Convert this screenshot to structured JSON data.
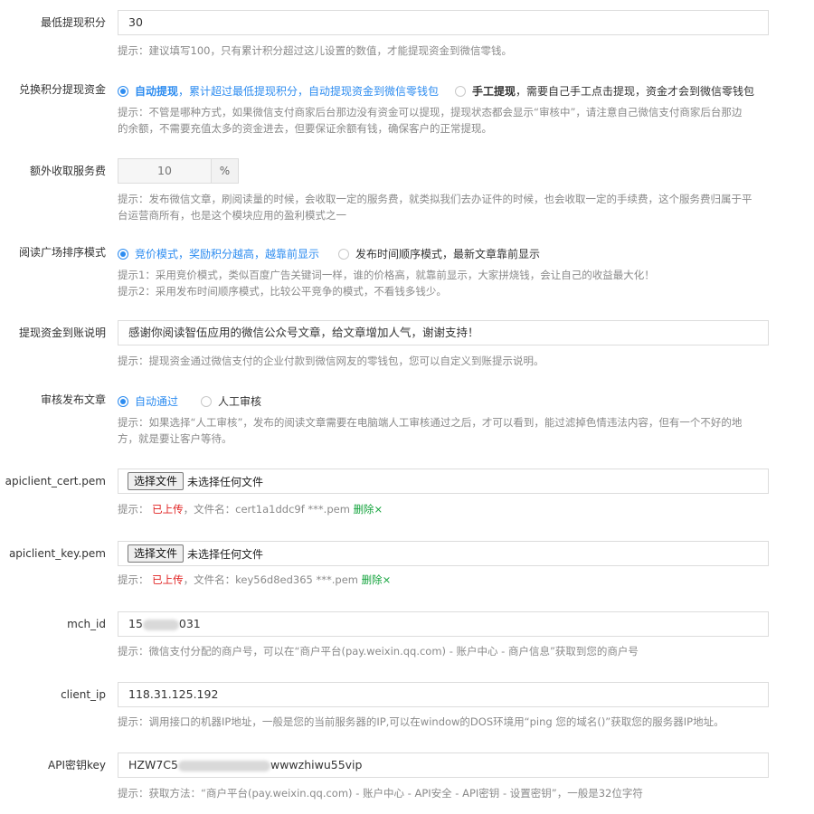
{
  "fields": {
    "min_points": {
      "label": "最低提现积分",
      "value": "30",
      "hint": "提示：建议填写100，只有累计积分超过这儿设置的数值，才能提现资金到微信零钱。"
    },
    "exchange_mode": {
      "label": "兑换积分提现资金",
      "option_auto_title": "自动提现",
      "option_auto_desc": "，累计超过最低提现积分，自动提现资金到微信零钱包",
      "option_manual_title": "手工提现",
      "option_manual_desc": "，需要自己手工点击提现，资金才会到微信零钱包",
      "selected": "auto",
      "hint_line1": "提示：不管是哪种方式，如果微信支付商家后台那边没有资金可以提现，提现状态都会显示“审核中”，请注意自己微信支付商家后台那边",
      "hint_line2": "的余额，不需要充值太多的资金进去，但要保证余额有钱，确保客户的正常提现。"
    },
    "service_fee": {
      "label": "额外收取服务费",
      "value": "10",
      "unit": "%",
      "hint_line1": "提示：发布微信文章，刷阅读量的时候，会收取一定的服务费，就类拟我们去办证件的时候，也会收取一定的手续费，这个服务费归属于平",
      "hint_line2": "台运营商所有，也是这个模块应用的盈利模式之一"
    },
    "sort_mode": {
      "label": "阅读广场排序模式",
      "option_bid": "竞价模式，奖励积分越高，越靠前显示",
      "option_time": "发布时间顺序模式，最新文章靠前显示",
      "selected": "bid",
      "hint_line1": "提示1：采用竞价模式，类似百度广告关键词一样，谁的价格高，就靠前显示，大家拼烧钱，会让自己的收益最大化！",
      "hint_line2": "提示2：采用发布时间顺序模式，比较公平竞争的模式，不看钱多钱少。"
    },
    "transfer_note": {
      "label": "提现资金到账说明",
      "value": "感谢你阅读智伍应用的微信公众号文章，给文章增加人气，谢谢支持！",
      "hint": "提示：提现资金通过微信支付的企业付款到微信网友的零钱包，您可以自定义到账提示说明。"
    },
    "review_mode": {
      "label": "审核发布文章",
      "option_auto": "自动通过",
      "option_manual": "人工审核",
      "selected": "auto",
      "hint_line1": "提示：如果选择“人工审核”，发布的阅读文章需要在电脑端人工审核通过之后，才可以看到，能过滤掉色情违法内容，但有一个不好的地",
      "hint_line2": "方，就是要让客户等待。"
    },
    "cert_pem": {
      "label": "apiclient_cert.pem",
      "button": "选择文件",
      "no_file": "未选择任何文件",
      "hint_prefix": "提示：",
      "status": "已上传",
      "file_label": "，文件名：",
      "file_name": "cert1a1ddc9f ***.pem",
      "delete": "删除×"
    },
    "key_pem": {
      "label": "apiclient_key.pem",
      "button": "选择文件",
      "no_file": "未选择任何文件",
      "hint_prefix": "提示：",
      "status": "已上传",
      "file_label": "，文件名：",
      "file_name": "key56d8ed365 ***.pem",
      "delete": "删除×"
    },
    "mch_id": {
      "label": "mch_id",
      "value_start": "15",
      "value_end": "031",
      "hint": "提示：微信支付分配的商户号，可以在“商户平台(pay.weixin.qq.com) - 账户中心 - 商户信息”获取到您的商户号"
    },
    "client_ip": {
      "label": "client_ip",
      "value": "118.31.125.192",
      "hint": "提示：调用接口的机器IP地址，一般是您的当前服务器的IP,可以在window的DOS环境用“ping 您的域名()”获取您的服务器IP地址。"
    },
    "api_key": {
      "label": "API密钥key",
      "value_start": "HZW7C5",
      "value_end": "wwwzhiwu55vip",
      "hint": "提示：获取方法：“商户平台(pay.weixin.qq.com) - 账户中心 - API安全 - API密钥 - 设置密钥”，一般是32位字符"
    }
  },
  "colors": {
    "accent": "#2d8cf0",
    "uploaded": "#e02020",
    "delete": "#12a33b",
    "hint": "#8a8a8a"
  }
}
